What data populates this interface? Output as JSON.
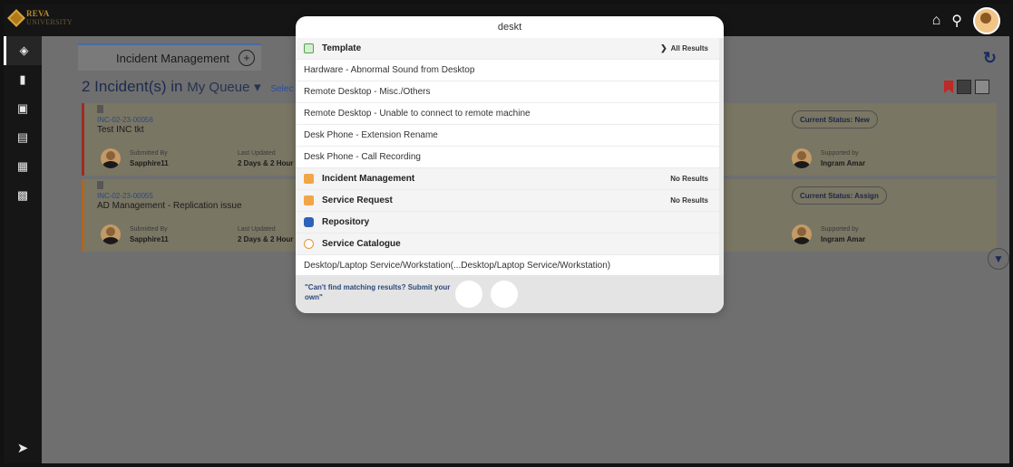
{
  "brand": {
    "name": "REVA",
    "sub": "UNIVERSITY"
  },
  "top_icons": [
    "home-icon",
    "search-icon",
    "avatar"
  ],
  "sidebar": {
    "items": [
      "tag-icon",
      "bar-chart-icon",
      "book-icon",
      "list-icon",
      "grid-icon",
      "monitor-eye-icon"
    ],
    "pin": "pin-icon"
  },
  "tab": {
    "label": "Incident Management"
  },
  "queue": {
    "count_label": "2 Incident(s) in",
    "queue_name": "My Queue",
    "select_label": "Selec"
  },
  "incidents": [
    {
      "id": "INC-02-23-00056",
      "title": "Test INC tkt",
      "submitted_label": "Submitted By",
      "submitted_by": "Sapphire11",
      "updated_label": "Last Updated",
      "updated": "2 Days & 2 Hour",
      "status": "Current Status: New",
      "supported_label": "Supported by",
      "supported_by": "Ingram Amar"
    },
    {
      "id": "INC-02-23-00055",
      "title": "AD Management - Replication issue",
      "submitted_label": "Submitted By",
      "submitted_by": "Sapphire11",
      "updated_label": "Last Updated",
      "updated": "2 Days & 2 Hour",
      "status": "Current Status: Assign",
      "supported_label": "Supported by",
      "supported_by": "Ingram Amar"
    }
  ],
  "search": {
    "query": "deskt",
    "template_group": {
      "label": "Template",
      "filter": "All Results"
    },
    "template_results": [
      "Hardware - Abnormal Sound from Desktop",
      "Remote Desktop - Misc./Others",
      "Remote Desktop - Unable to connect to remote machine",
      "Desk Phone - Extension Rename",
      "Desk Phone - Call Recording"
    ],
    "groups": [
      {
        "label": "Incident Management",
        "status": "No Results"
      },
      {
        "label": "Service Request",
        "status": "No Results"
      },
      {
        "label": "Repository",
        "status": ""
      },
      {
        "label": "Service Catalogue",
        "status": ""
      }
    ],
    "catalogue_result": "Desktop/Laptop Service/Workstation(...Desktop/Laptop Service/Workstation)",
    "footer_text": "\"Can't find matching results? Submit your own\""
  }
}
